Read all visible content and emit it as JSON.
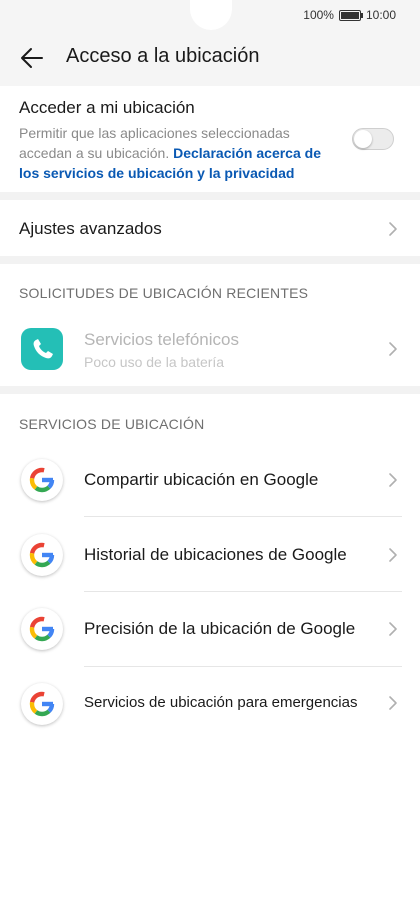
{
  "status_bar": {
    "battery": "100%",
    "time": "10:00"
  },
  "header": {
    "title": "Acceso a la ubicación"
  },
  "location_access": {
    "label": "Acceder a mi ubicación",
    "description": "Permitir que las aplicaciones seleccionadas accedan a su ubicación.",
    "link": "Declaración acerca de los servicios de ubicación y la privacidad",
    "toggle_on": false
  },
  "advanced": {
    "label": "Ajustes avanzados"
  },
  "recent_requests": {
    "title": "SOLICITUDES DE UBICACIÓN RECIENTES",
    "items": [
      {
        "name": "Servicios telefónicos",
        "detail": "Poco uso de la batería"
      }
    ]
  },
  "location_services": {
    "title": "SERVICIOS DE UBICACIÓN",
    "items": [
      {
        "label": "Compartir ubicación en Google"
      },
      {
        "label": "Historial de ubicaciones de Google"
      },
      {
        "label": "Precisión de la ubicación de Google"
      },
      {
        "label": "Servicios de ubicación para emergencias"
      }
    ]
  }
}
